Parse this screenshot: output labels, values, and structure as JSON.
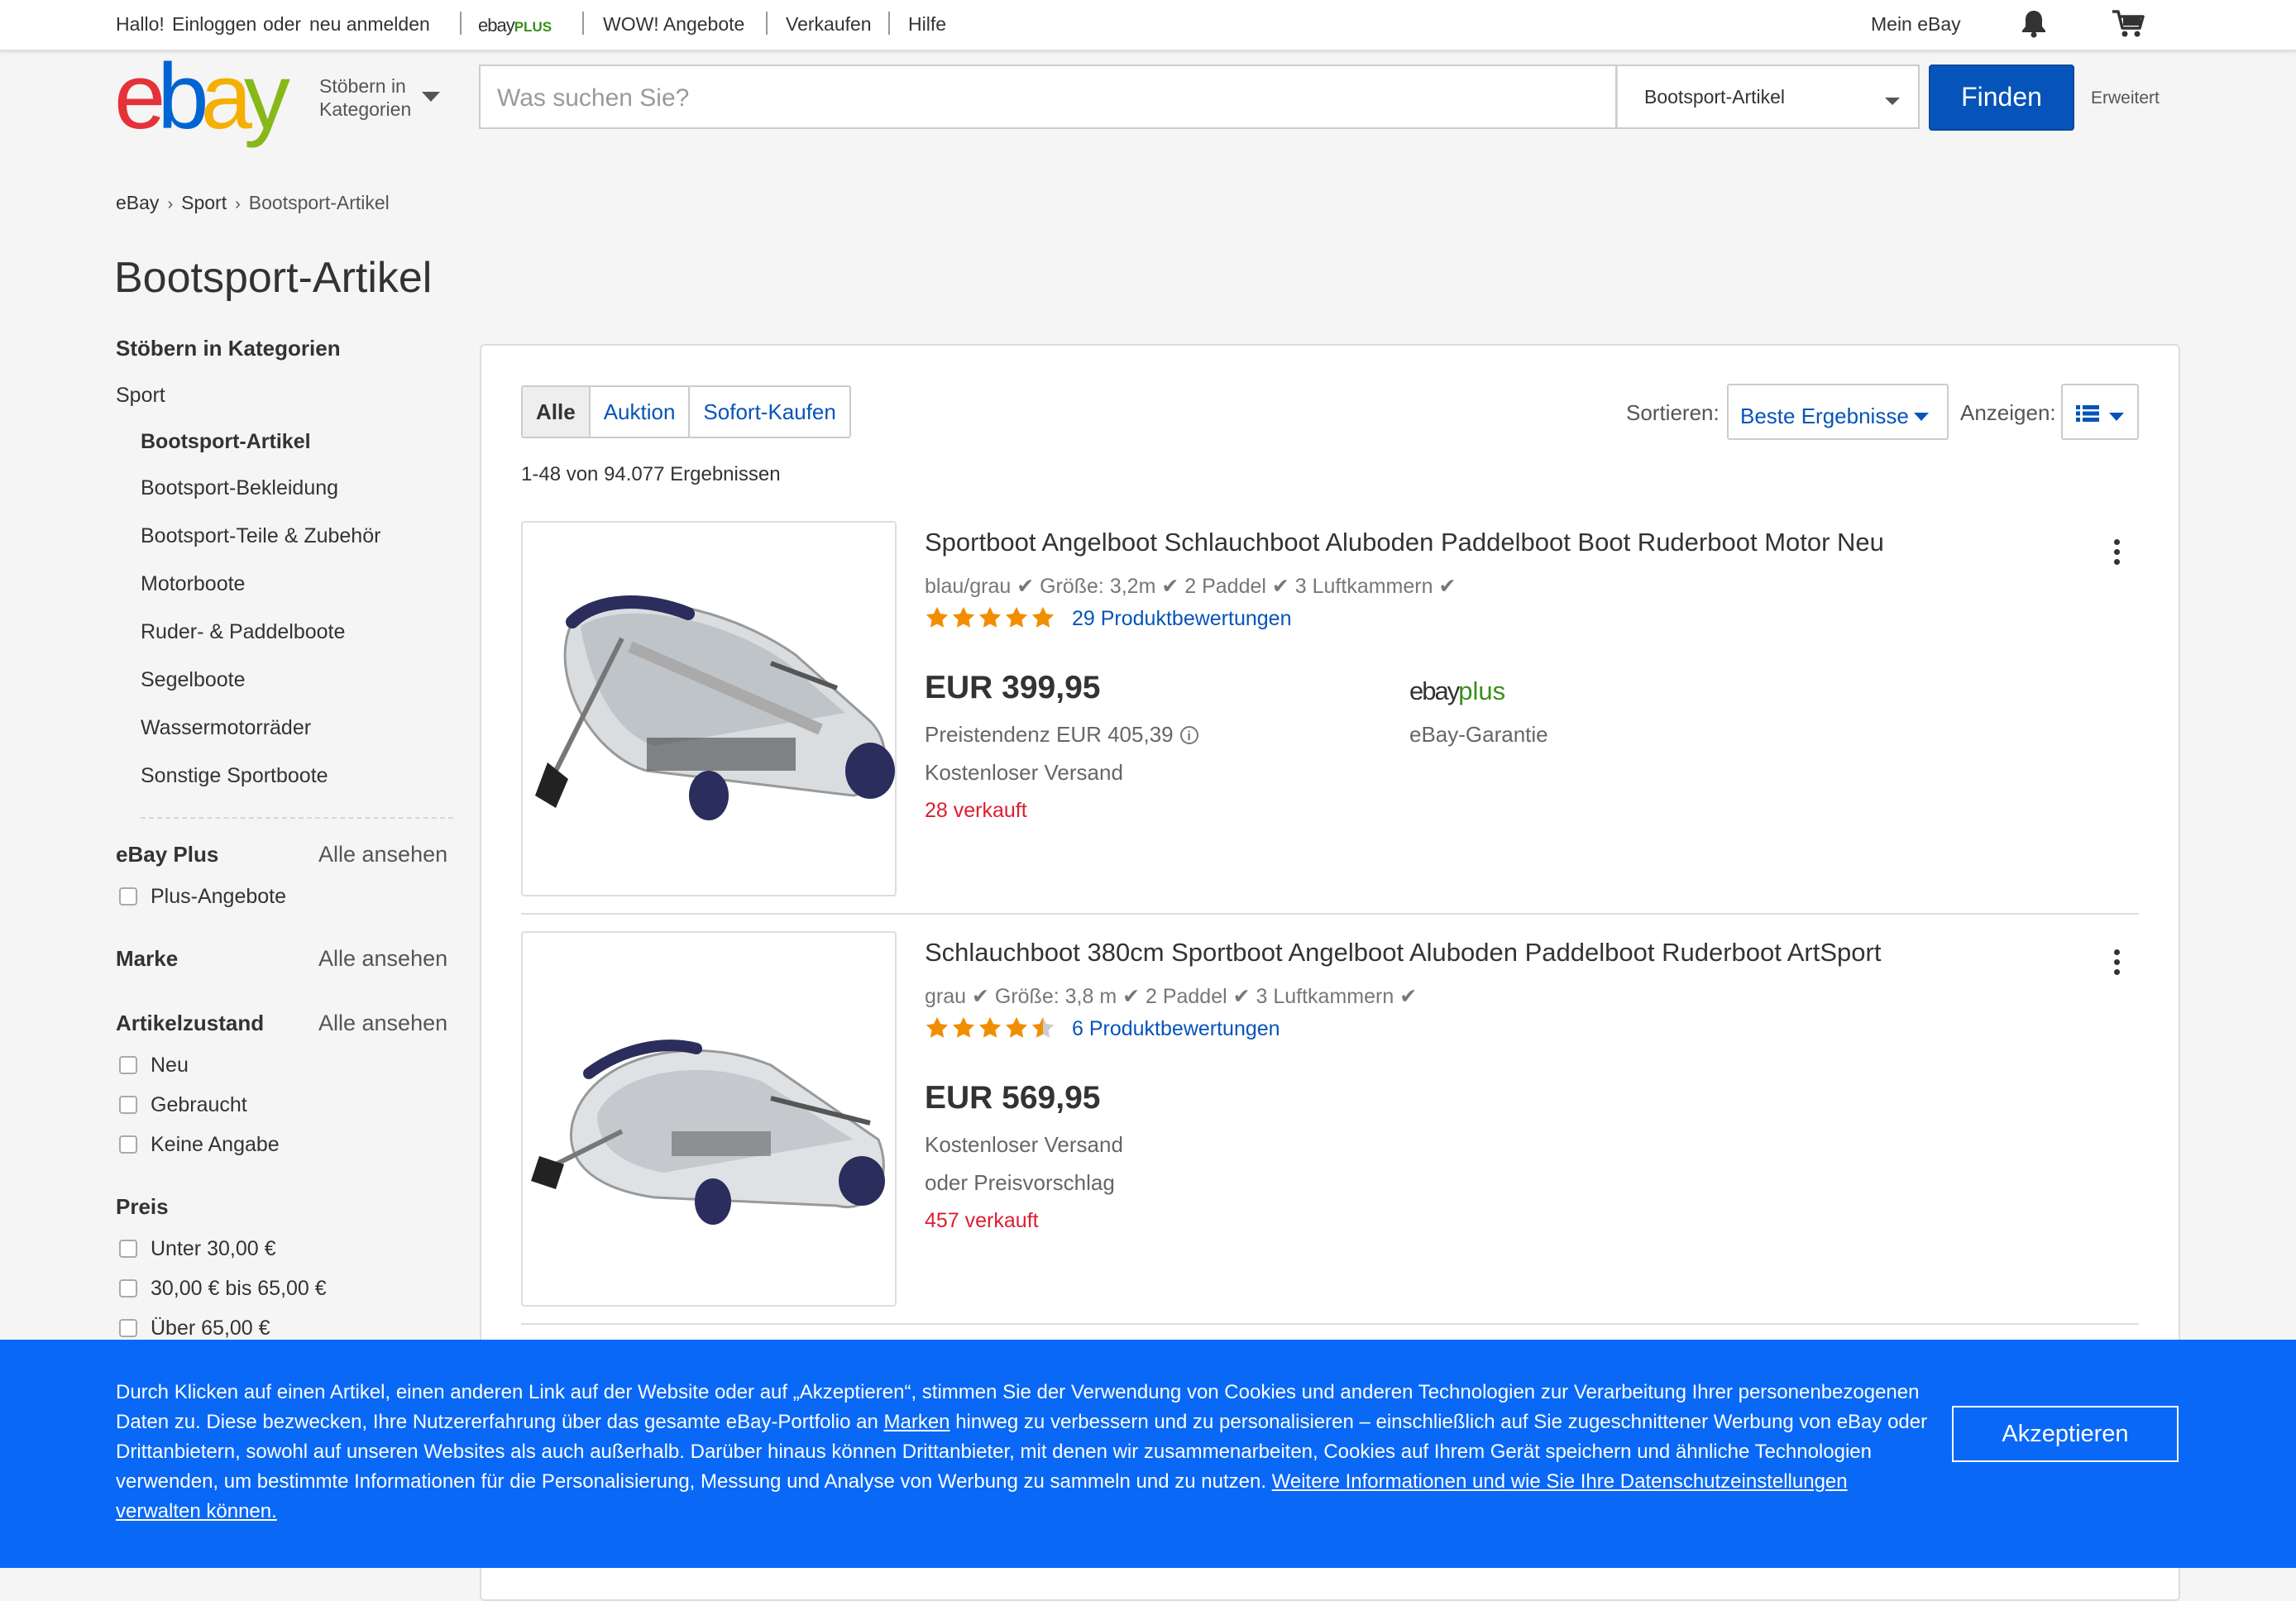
{
  "topbar": {
    "greeting": "Hallo!",
    "signin": "Einloggen",
    "or": "oder",
    "register": "neu anmelden",
    "plus_logo_ebay": "ebay",
    "plus_logo_plus": "PLUS",
    "deals": "WOW! Angebote",
    "sell": "Verkaufen",
    "help": "Hilfe",
    "my_ebay": "Mein eBay"
  },
  "header": {
    "logo_letters": [
      "e",
      "b",
      "a",
      "y"
    ],
    "logo_colors": [
      "#e53238",
      "#0064d2",
      "#f5af02",
      "#86b817"
    ],
    "browse_line1": "Stöbern in",
    "browse_line2": "Kategorien",
    "search_placeholder": "Was suchen Sie?",
    "category": "Bootsport-Artikel",
    "find_button": "Finden",
    "advanced": "Erweitert"
  },
  "breadcrumb": [
    "eBay",
    "Sport",
    "Bootsport-Artikel"
  ],
  "page_title": "Bootsport-Artikel",
  "sidebar": {
    "categories_heading": "Stöbern in Kategorien",
    "parent": "Sport",
    "current": "Bootsport-Artikel",
    "subcategories": [
      "Bootsport-Bekleidung",
      "Bootsport-Teile & Zubehör",
      "Motorboote",
      "Ruder- & Paddelboote",
      "Segelboote",
      "Wassermotorräder",
      "Sonstige Sportboote"
    ],
    "see_all": "Alle ansehen",
    "ebay_plus": {
      "heading": "eBay Plus",
      "options": [
        "Plus-Angebote"
      ]
    },
    "brand": {
      "heading": "Marke"
    },
    "condition": {
      "heading": "Artikelzustand",
      "options": [
        "Neu",
        "Gebraucht",
        "Keine Angabe"
      ]
    },
    "price": {
      "heading": "Preis",
      "options": [
        "Unter 30,00 €",
        "30,00 € bis 65,00 €",
        "Über 65,00 €"
      ]
    }
  },
  "results": {
    "tabs": [
      "Alle",
      "Auktion",
      "Sofort-Kaufen"
    ],
    "active_tab": "Alle",
    "sort_label": "Sortieren:",
    "sort_value": "Beste Ergebnisse",
    "view_label": "Anzeigen:",
    "count": "1-48 von 94.077 Ergebnissen",
    "items": [
      {
        "title": "Sportboot Angelboot Schlauchboot Aluboden Paddelboot Boot Ruderboot Motor Neu",
        "subtitle": "blau/grau ✔ Größe: 3,2m ✔ 2 Paddel ✔ 3 Luftkammern ✔",
        "rating": 5,
        "reviews": "29 Produktbewertungen",
        "price": "EUR 399,95",
        "trend": "Preistendenz EUR 405,39",
        "shipping": "Kostenloser Versand",
        "sold": "28 verkauft",
        "plus_logo_ebay": "ebay",
        "plus_logo_plus": "plus",
        "guarantee": "eBay-Garantie"
      },
      {
        "title": "Schlauchboot 380cm Sportboot Angelboot Aluboden Paddelboot Ruderboot ArtSport",
        "subtitle": "grau ✔ Größe: 3,8 m ✔ 2 Paddel ✔ 3 Luftkammern ✔",
        "rating": 4.5,
        "reviews": "6 Produktbewertungen",
        "price": "EUR 569,95",
        "shipping": "Kostenloser Versand",
        "offer": "oder Preisvorschlag",
        "sold": "457 verkauft"
      }
    ]
  },
  "cookie_banner": {
    "text_1": "Durch Klicken auf einen Artikel, einen anderen Link auf der Website oder auf „Akzeptieren“, stimmen Sie der Verwendung von Cookies und anderen Technologien zur Verarbeitung Ihrer personenbezogenen Daten zu. Diese bezwecken, Ihre Nutzererfahrung über das gesamte eBay-Portfolio an ",
    "brands_link": "Marken",
    "text_2": " hinweg zu verbessern und zu personalisieren – einschließlich auf Sie zugeschnittener Werbung von eBay oder Drittanbietern, sowohl auf unseren Websites als auch außerhalb. Darüber hinaus können Drittanbieter, mit denen wir zusammenarbeiten, Cookies auf Ihrem Gerät speichern und ähnliche Technologien verwenden, um bestimmte Informationen für die Personalisierung, Messung und Analyse von Werbung zu sammeln und zu nutzen. ",
    "more_link": "Weitere Informationen und wie Sie Ihre Datenschutzeinstellungen verwalten können.",
    "accept": "Akzeptieren"
  },
  "colors": {
    "link_blue": "#0654ba",
    "find_button": "#0654ba",
    "banner": "#0968f6",
    "sold_red": "#dd1e31",
    "star": "#f18e00",
    "plus_green": "#3a8e1b"
  }
}
